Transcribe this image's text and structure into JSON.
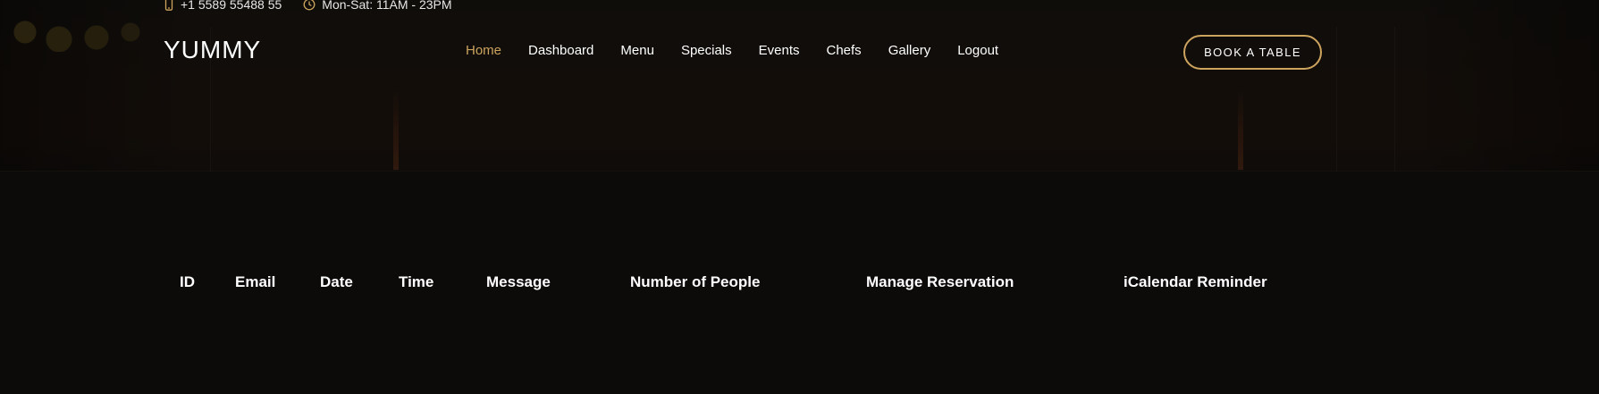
{
  "topbar": {
    "phone": "+1 5589 55488 55",
    "hours": "Mon-Sat: 11AM - 23PM",
    "phone_icon": "phone-icon",
    "clock_icon": "clock-icon"
  },
  "header": {
    "logo": "YUMMY",
    "nav": [
      "Home",
      "Dashboard",
      "Menu",
      "Specials",
      "Events",
      "Chefs",
      "Gallery",
      "Logout"
    ],
    "active_nav": "Home",
    "book_button": "BOOK A TABLE"
  },
  "reservations_table": {
    "columns": [
      "ID",
      "Email",
      "Date",
      "Time",
      "Message",
      "Number of People",
      "Manage Reservation",
      "iCalendar Reminder"
    ],
    "rows": []
  },
  "colors": {
    "accent": "#cda45e",
    "background": "#0c0b09",
    "text": "#ffffff"
  }
}
